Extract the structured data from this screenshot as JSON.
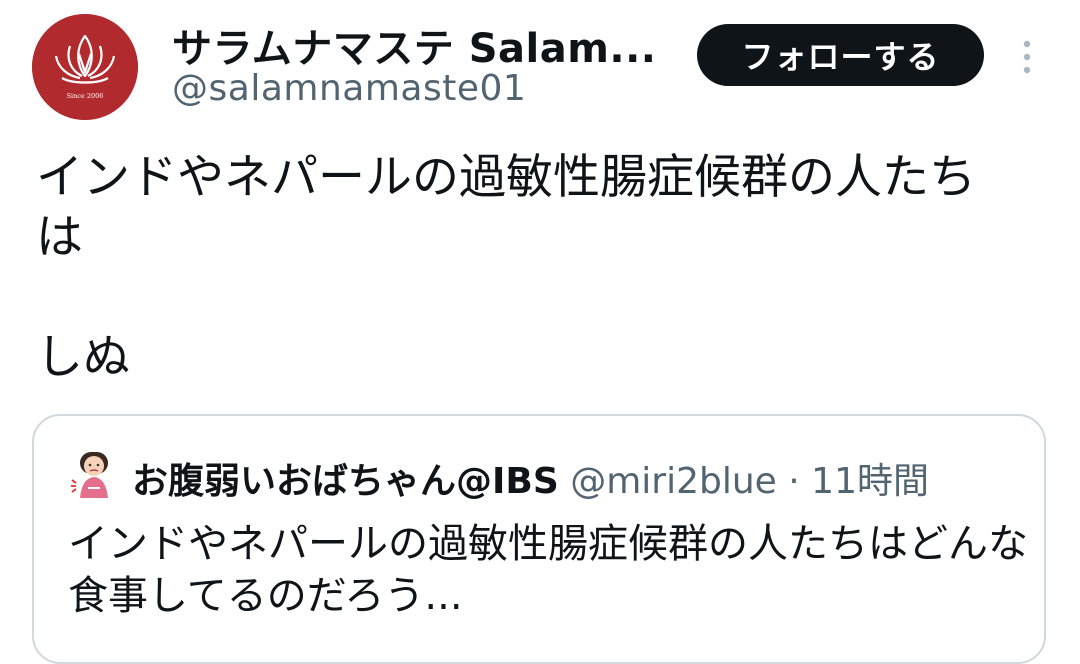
{
  "author": {
    "display_name": "サラムナマステ Salam...",
    "handle": "@salamnamaste01",
    "avatar_caption": "Since 2006"
  },
  "follow_button_label": "フォローする",
  "tweet": {
    "text": "インドやネパールの過敏性腸症候群の人たち\nは\n\nしぬ"
  },
  "quoted_tweet": {
    "display_name": "お腹弱いおばちゃん@IBS",
    "handle": "@miri2blue",
    "separator": " · ",
    "time": "11時間",
    "text": "インドやネパールの過敏性腸症候群の人たちはどんな食事してるのだろう..."
  },
  "colors": {
    "avatar_bg": "#b02a2e",
    "follow_button_bg": "#0f1419",
    "secondary_text": "#536471",
    "card_border": "#cfd9de"
  },
  "icons": {
    "more": "more-dots-vertical-icon",
    "avatar": "lotus-praying-hands-logo",
    "quote_avatar": "woman-holding-stomach-icon"
  }
}
